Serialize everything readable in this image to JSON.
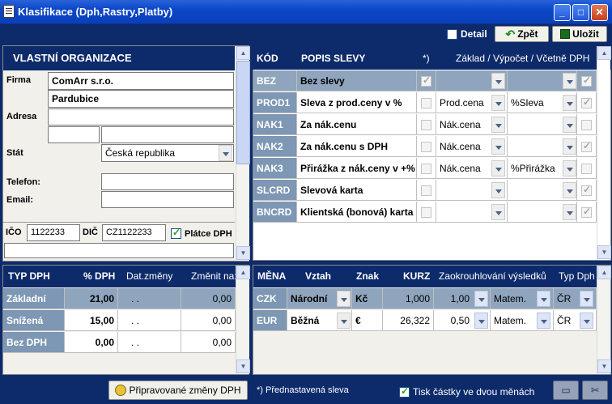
{
  "window": {
    "title": "Klasifikace (Dph,Rastry,Platby)"
  },
  "toolbar": {
    "detail_label": "Detail",
    "back_label": "Zpět",
    "save_label": "Uložit"
  },
  "org": {
    "header": "VLASTNÍ ORGANIZACE",
    "firma_label": "Firma",
    "firma_value": "ComArr s.r.o.",
    "firma_value2": "Pardubice",
    "adresa_label": "Adresa",
    "stat_label": "Stát",
    "stat_value": "Česká republika",
    "telefon_label": "Telefon:",
    "email_label": "Email:",
    "ico_label": "IČO",
    "ico_value": "1122233",
    "dic_label": "DIČ",
    "dic_value": "CZ1122233",
    "platce_label": "Plátce DPH"
  },
  "discounts": {
    "headers": {
      "code": "KÓD",
      "desc": "POPIS SLEVY",
      "flag": "*)",
      "calc": "Základ / Výpočet / Včetně DPH"
    },
    "rows": [
      {
        "code": "BEZ",
        "desc": "Bez slevy",
        "preset": true,
        "base": "",
        "calc": "",
        "incl": true
      },
      {
        "code": "PROD1",
        "desc": "Sleva z prod.ceny v %",
        "preset": false,
        "base": "Prod.cena",
        "calc": "%Sleva",
        "incl": true
      },
      {
        "code": "NAK1",
        "desc": "Za nák.cenu",
        "preset": false,
        "base": "Nák.cena",
        "calc": "",
        "incl": false
      },
      {
        "code": "NAK2",
        "desc": "Za nák.cenu s DPH",
        "preset": false,
        "base": "Nák.cena",
        "calc": "",
        "incl": true
      },
      {
        "code": "NAK3",
        "desc": "Přirážka z nák.ceny v +%",
        "preset": false,
        "base": "Nák.cena",
        "calc": "%Přirážka",
        "incl": false
      },
      {
        "code": "SLCRD",
        "desc": "Slevová karta",
        "preset": false,
        "base": "",
        "calc": "",
        "incl": true
      },
      {
        "code": "BNCRD",
        "desc": "Klientská (bonová) karta",
        "preset": false,
        "base": "",
        "calc": "",
        "incl": true
      }
    ]
  },
  "vat": {
    "headers": {
      "type": "TYP DPH",
      "rate": "% DPH",
      "date": "Dat.změny",
      "change": "Změnit na:"
    },
    "rows": [
      {
        "type": "Základní",
        "rate": "21,00",
        "date": ". .",
        "change": "0,00"
      },
      {
        "type": "Snížená",
        "rate": "15,00",
        "date": ". .",
        "change": "0,00"
      },
      {
        "type": "Bez DPH",
        "rate": "0,00",
        "date": ". .",
        "change": "0,00"
      }
    ]
  },
  "currency": {
    "headers": {
      "code": "MĚNA",
      "rel": "Vztah",
      "sign": "Znak",
      "rate": "KURZ",
      "round": "Zaokrouhlování výsledků",
      "vat": "Typ Dph"
    },
    "rows": [
      {
        "code": "CZK",
        "rel": "Národní",
        "sign": "Kč",
        "rate": "1,000",
        "round": "1,00",
        "method": "Matem.",
        "vat": "ČR"
      },
      {
        "code": "EUR",
        "rel": "Běžná",
        "sign": "€",
        "rate": "26,322",
        "round": "0,50",
        "method": "Matem.",
        "vat": "ČR"
      }
    ]
  },
  "status": {
    "planned_label": "Připravované změny DPH",
    "footnote": "*) Přednastavená sleva",
    "print_label": "Tisk částky ve dvou měnách"
  }
}
